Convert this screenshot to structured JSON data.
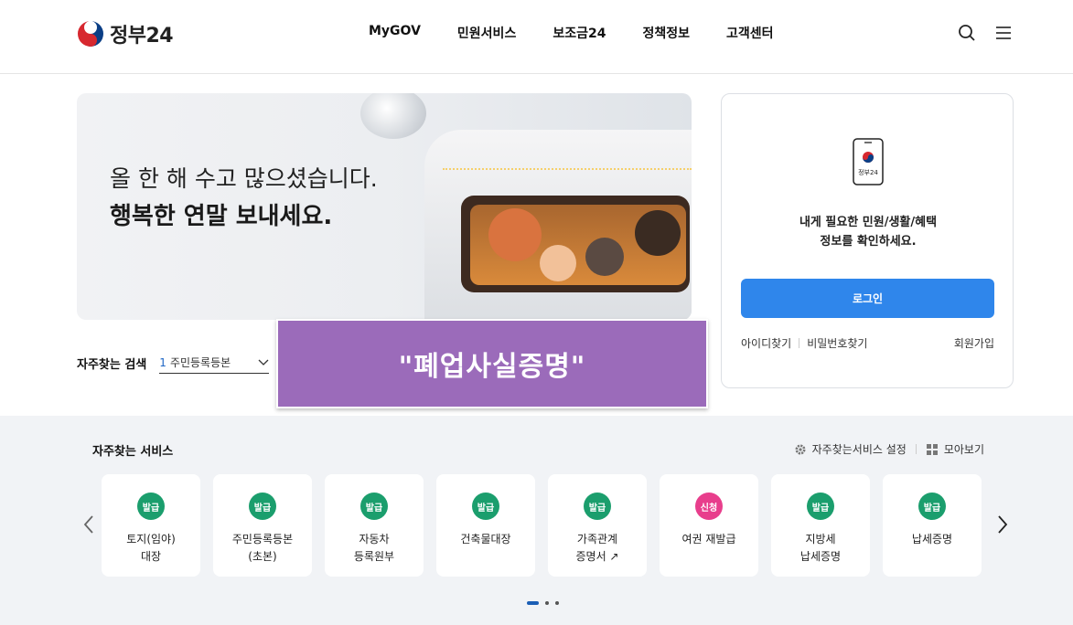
{
  "header": {
    "logo_text": "정부24",
    "nav": [
      "MyGOV",
      "민원서비스",
      "보조금24",
      "정책정보",
      "고객센터"
    ],
    "icons": [
      "search-icon",
      "menu-icon"
    ]
  },
  "banner": {
    "line1": "올 한 해 수고 많으셨습니다.",
    "line2": "행복한 연말 보내세요."
  },
  "search": {
    "title": "자주찾는 검색",
    "rank": "1",
    "value": "주민등록등본"
  },
  "overlay": {
    "text": "\"폐업사실증명\""
  },
  "login": {
    "phone_label": "정부24",
    "message_line1": "내게 필요한 민원/생활/혜택",
    "message_line2": "정보를 확인하세요.",
    "button": "로그인",
    "find_id": "아이디찾기",
    "find_pw": "비밀번호찾기",
    "signup": "회원가입"
  },
  "services": {
    "title": "자주찾는 서비스",
    "settings": "자주찾는서비스 설정",
    "view_all": "모아보기",
    "items": [
      {
        "badge": "발급",
        "label": "토지(임야)\n대장",
        "color": "green"
      },
      {
        "badge": "발급",
        "label": "주민등록등본\n(초본)",
        "color": "green"
      },
      {
        "badge": "발급",
        "label": "자동차\n등록원부",
        "color": "green"
      },
      {
        "badge": "발급",
        "label": "건축물대장",
        "color": "green"
      },
      {
        "badge": "발급",
        "label": "가족관계\n증명서 ↗",
        "color": "green"
      },
      {
        "badge": "신청",
        "label": "여권 재발급",
        "color": "pink"
      },
      {
        "badge": "발급",
        "label": "지방세\n납세증명",
        "color": "green"
      },
      {
        "badge": "발급",
        "label": "납세증명",
        "color": "green"
      }
    ],
    "colors": {
      "green": "#1b9e6d",
      "pink": "#e83e8c"
    }
  },
  "colors": {
    "accent": "#2f86eb",
    "overlay": "#9b6bba"
  }
}
